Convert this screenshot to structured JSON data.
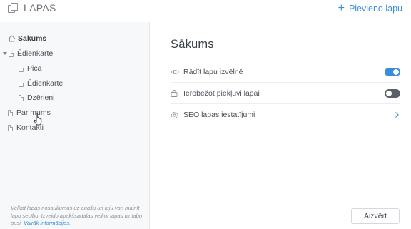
{
  "header": {
    "title": "LAPAS",
    "add_page_label": "Pievieno lapu"
  },
  "sidebar": {
    "items": [
      {
        "label": "Sākums",
        "icon": "home-icon",
        "active": true
      },
      {
        "label": "Ēdienkarte",
        "icon": "doc-icon",
        "expanded": true
      },
      {
        "label": "Pica",
        "icon": "doc-icon"
      },
      {
        "label": "Ēdienkarte",
        "icon": "doc-icon"
      },
      {
        "label": "Dzērieni",
        "icon": "doc-icon"
      },
      {
        "label": "Par mums",
        "icon": "doc-icon"
      },
      {
        "label": "Kontakti",
        "icon": "doc-icon"
      }
    ],
    "footer_text": "Velkot lapas nosaukumus uz augšu un leju vari mainīt lapu secību. Izveido apakšsadaļas velkot lapas uz labo pusi.",
    "footer_link": "Vairāk informācijas."
  },
  "main": {
    "title": "Sākums",
    "settings": [
      {
        "label": "Rādīt lapu izvēlnē",
        "icon": "eye-icon",
        "control": "toggle",
        "value": true
      },
      {
        "label": "Ierobežot piekļuvi lapai",
        "icon": "lock-icon",
        "control": "toggle",
        "value": false
      },
      {
        "label": "SEO lapas iestatījumi",
        "icon": "gear-icon",
        "control": "chevron"
      }
    ],
    "close_label": "Aizvērt"
  },
  "colors": {
    "accent": "#3a8ddc",
    "toggle_off": "#5b6068",
    "sidebar_bg": "#f7f8f9"
  }
}
